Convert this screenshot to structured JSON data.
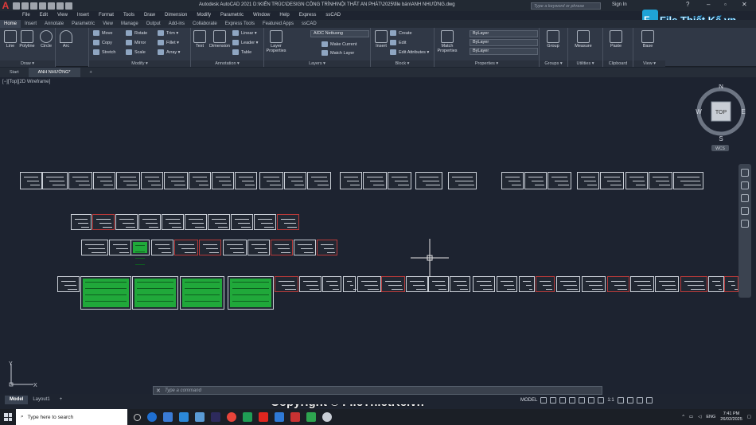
{
  "title_bar": {
    "app_initial": "A",
    "title": "Autodesk AutoCAD 2021   D:\\KIẾN TRÚC\\DESIGN CÔNG TRÌNH\\NỘI THẤT AN PHÁT\\2025\\file bán\\ANH NHƯỜNG.dwg",
    "search_placeholder": "Type a keyword or phrase",
    "sign_in": "Sign In"
  },
  "menu": [
    "File",
    "Edit",
    "View",
    "Insert",
    "Format",
    "Tools",
    "Draw",
    "Dimension",
    "Modify",
    "Parametric",
    "Window",
    "Help",
    "Express",
    "ssCAD"
  ],
  "ribbon_tabs": [
    "Home",
    "Insert",
    "Annotate",
    "Parametric",
    "View",
    "Manage",
    "Output",
    "Add-ins",
    "Collaborate",
    "Express Tools",
    "Featured Apps",
    "ssCAD"
  ],
  "ribbon": {
    "draw": {
      "title": "Draw ▾",
      "line": "Line",
      "polyline": "Polyline",
      "circle": "Circle",
      "arc": "Arc"
    },
    "modify": {
      "title": "Modify ▾",
      "move": "Move",
      "rotate": "Rotate",
      "trim": "Trim ▾",
      "copy": "Copy",
      "mirror": "Mirror",
      "fillet": "Fillet ▾",
      "stretch": "Stretch",
      "scale": "Scale",
      "array": "Array ▾"
    },
    "annotation": {
      "title": "Annotation ▾",
      "text": "Text",
      "dimension": "Dimension",
      "linear": "Linear ▾",
      "leader": "Leader ▾",
      "table": "Table"
    },
    "layers": {
      "title": "Layers ▾",
      "layer_properties": "Layer Properties",
      "current_layer": "AIDC Nettuong",
      "make_current": "Make Current",
      "match_layer": "Match Layer"
    },
    "block": {
      "title": "Block ▾",
      "insert": "Insert",
      "create": "Create",
      "edit": "Edit",
      "edit_attributes": "Edit Attributes ▾"
    },
    "properties": {
      "title": "Properties ▾",
      "match_properties": "Match Properties",
      "color": "ByLayer",
      "linetype": "ByLayer",
      "lineweight": "ByLayer"
    },
    "groups": {
      "title": "Groups ▾",
      "group": "Group"
    },
    "utilities": {
      "title": "Utilities ▾",
      "measure": "Measure"
    },
    "clipboard": {
      "title": "Clipboard",
      "paste": "Paste"
    },
    "view": {
      "title": "View ▾",
      "base": "Base"
    }
  },
  "doc_tabs": {
    "start": "Start",
    "active": "ANH NHƯỜNG*",
    "add": "+"
  },
  "viewport_label": "[−][Top][2D Wireframe]",
  "viewcube": {
    "n": "N",
    "s": "S",
    "e": "E",
    "w": "W",
    "face": "TOP",
    "wcs": "WCS"
  },
  "ucs": {
    "x": "X",
    "y": "Y"
  },
  "command_line": {
    "placeholder": "Type a command"
  },
  "layout_tabs": {
    "model": "Model",
    "layout1": "Layout1",
    "add": "+"
  },
  "status_bar": {
    "model": "MODEL",
    "scale": "1:1"
  },
  "watermark": "Copyright © FileThietKe.vn",
  "brand_logo": "File Thiết Kế.vn",
  "taskbar": {
    "search_placeholder": "Type here to search",
    "lang": "ENG",
    "time": "7:41 PM",
    "date": "26/02/2025"
  },
  "colors": {
    "accent_red": "#b83a3a",
    "sheet_green": "#20a83a",
    "canvas": "#1d2330"
  }
}
